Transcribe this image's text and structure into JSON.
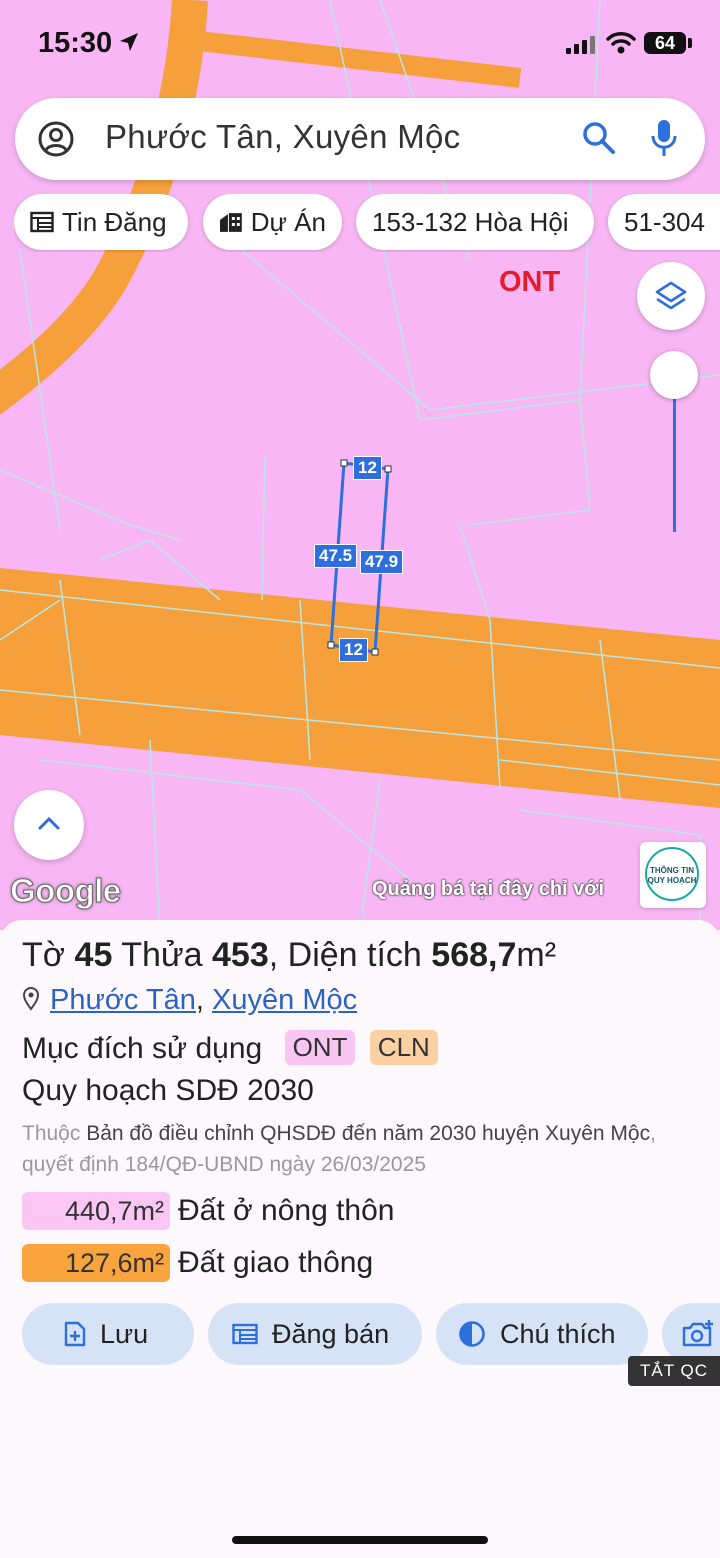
{
  "status_bar": {
    "time": "15:30",
    "battery": "64"
  },
  "search": {
    "text": "Phước Tân, Xuyên Mộc"
  },
  "chips": [
    {
      "label": "Tin Đăng",
      "icon": "listing-icon"
    },
    {
      "label": "Dự Án",
      "icon": "building-icon"
    },
    {
      "label": "153-132 Hòa Hội",
      "icon": ""
    },
    {
      "label": "51-304",
      "icon": ""
    }
  ],
  "map": {
    "zone_label": "ONT",
    "dimensions": {
      "top": "12",
      "bottom": "12",
      "left": "47.5",
      "right": "47.9"
    },
    "google": "Google",
    "ad_text": "Quảng bá tại đây chỉ với",
    "logo_text": "THÔNG TIN QUY HOẠCH"
  },
  "parcel": {
    "to_label": "Tờ",
    "to_value": "45",
    "thua_label": "Thửa",
    "thua_value": "453",
    "area_label": "Diện tích",
    "area_value": "568,7",
    "area_unit": "m²",
    "ward": "Phước Tân",
    "district": "Xuyên Mộc",
    "purpose_label": "Mục đích sử dụng",
    "purpose_tags": [
      "ONT",
      "CLN"
    ],
    "plan_title": "Quy hoạch SDĐ 2030",
    "desc_prefix": "Thuộc",
    "desc_main": "Bản đồ điều chỉnh QHSDĐ đến năm 2030 huyện Xuyên Mộc",
    "desc_suffix": ", quyết định 184/QĐ-UBND ngày 26/03/2025",
    "areas": [
      {
        "value": "440,7m²",
        "label": "Đất ở nông thôn",
        "color": "#fbc6f4"
      },
      {
        "value": "127,6m²",
        "label": "Đất giao thông",
        "color": "#f9a43d"
      }
    ]
  },
  "actions": [
    {
      "label": "Lưu",
      "icon": "add-file-icon"
    },
    {
      "label": "Đăng bán",
      "icon": "listing-icon"
    },
    {
      "label": "Chú thích",
      "icon": "contrast-icon"
    },
    {
      "label": "",
      "icon": "add-photo-icon"
    }
  ],
  "ad_toggle": "TẮT QC",
  "colors": {
    "accent": "#2d6fdc",
    "residential": "#f8b6f4",
    "road": "#f9a43d"
  }
}
